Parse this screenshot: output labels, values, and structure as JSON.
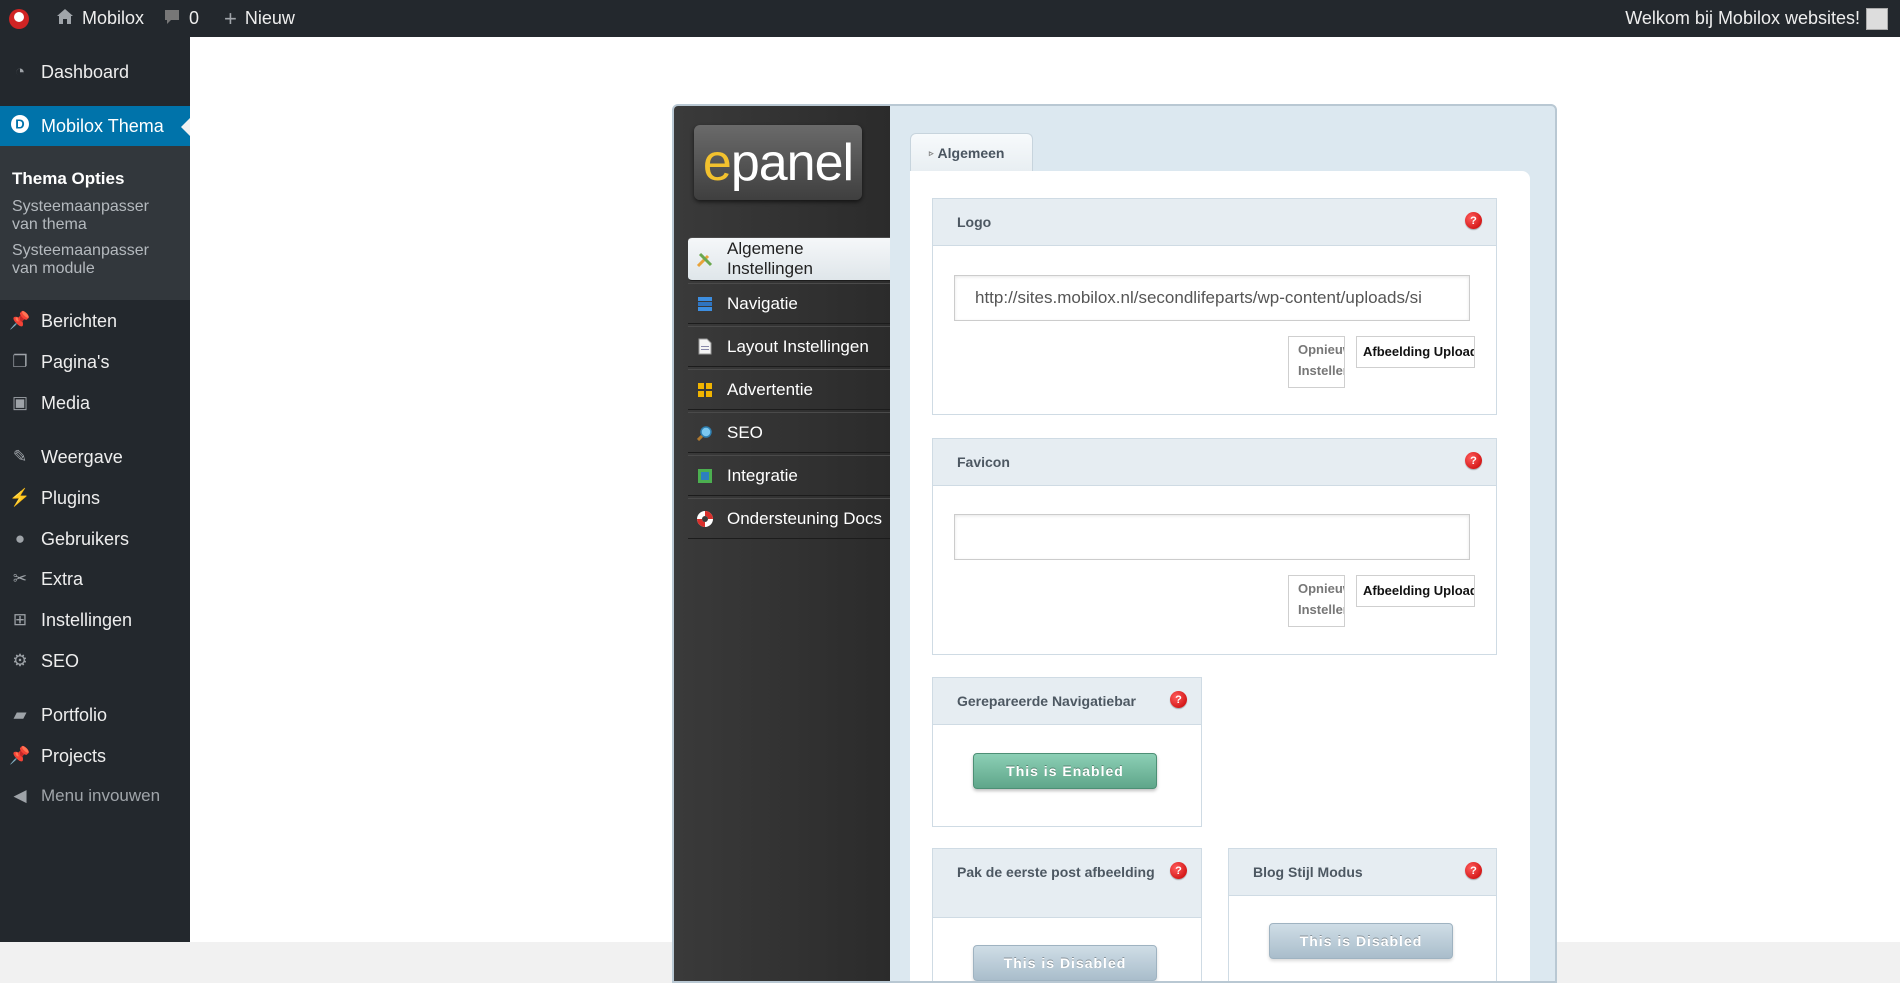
{
  "adminbar": {
    "site_name": "Mobilox",
    "comments_count": "0",
    "new_label": "Nieuw",
    "welcome": "Welkom bij Mobilox websites!"
  },
  "menu": {
    "items": [
      {
        "label": "Dashboard",
        "icon": "dashboard-icon"
      },
      {
        "label": "Mobilox Thema",
        "icon": "divi-d-icon"
      },
      {
        "label": "Berichten",
        "icon": "pin-icon"
      },
      {
        "label": "Pagina's",
        "icon": "pages-icon"
      },
      {
        "label": "Media",
        "icon": "media-icon"
      },
      {
        "label": "Weergave",
        "icon": "brush-icon"
      },
      {
        "label": "Plugins",
        "icon": "plugin-icon"
      },
      {
        "label": "Gebruikers",
        "icon": "user-icon"
      },
      {
        "label": "Extra",
        "icon": "wrench-icon"
      },
      {
        "label": "Instellingen",
        "icon": "settings-icon"
      },
      {
        "label": "SEO",
        "icon": "seo-icon"
      },
      {
        "label": "Portfolio",
        "icon": "folder-icon"
      },
      {
        "label": "Projects",
        "icon": "pin-icon"
      }
    ],
    "submenu": [
      {
        "label": "Thema Opties"
      },
      {
        "label": "Systeemaanpasser van thema"
      },
      {
        "label": "Systeemaanpasser van module"
      }
    ],
    "collapse_label": "Menu invouwen"
  },
  "epanel": {
    "logo_text_first": "e",
    "logo_text_rest": "panel",
    "nav": [
      {
        "label": "Algemene Instellingen",
        "icon": "tools-icon"
      },
      {
        "label": "Navigatie",
        "icon": "list-icon"
      },
      {
        "label": "Layout Instellingen",
        "icon": "document-icon"
      },
      {
        "label": "Advertentie",
        "icon": "grid-icon"
      },
      {
        "label": "SEO",
        "icon": "magnifier-icon"
      },
      {
        "label": "Integratie",
        "icon": "integration-icon"
      },
      {
        "label": "Ondersteuning Docs",
        "icon": "lifebuoy-icon"
      }
    ],
    "tab": "Algemeen",
    "help_glyph": "?",
    "logo_box": {
      "title": "Logo",
      "value": "http://sites.mobilox.nl/secondlifeparts/wp-content/uploads/si",
      "reset": "Opnieuw Instellen",
      "upload": "Afbeelding Uploaden"
    },
    "favicon_box": {
      "title": "Favicon",
      "value": "",
      "reset": "Opnieuw Instellen",
      "upload": "Afbeelding Uploaden"
    },
    "navbar_box": {
      "title": "Gerepareerde Navigatiebar",
      "toggle": "This is Enabled"
    },
    "firstpost_box": {
      "title": "Pak de eerste post afbeelding",
      "toggle": "This is Disabled"
    },
    "blogstyle_box": {
      "title": "Blog Stijl Modus",
      "toggle": "This is Disabled"
    }
  }
}
